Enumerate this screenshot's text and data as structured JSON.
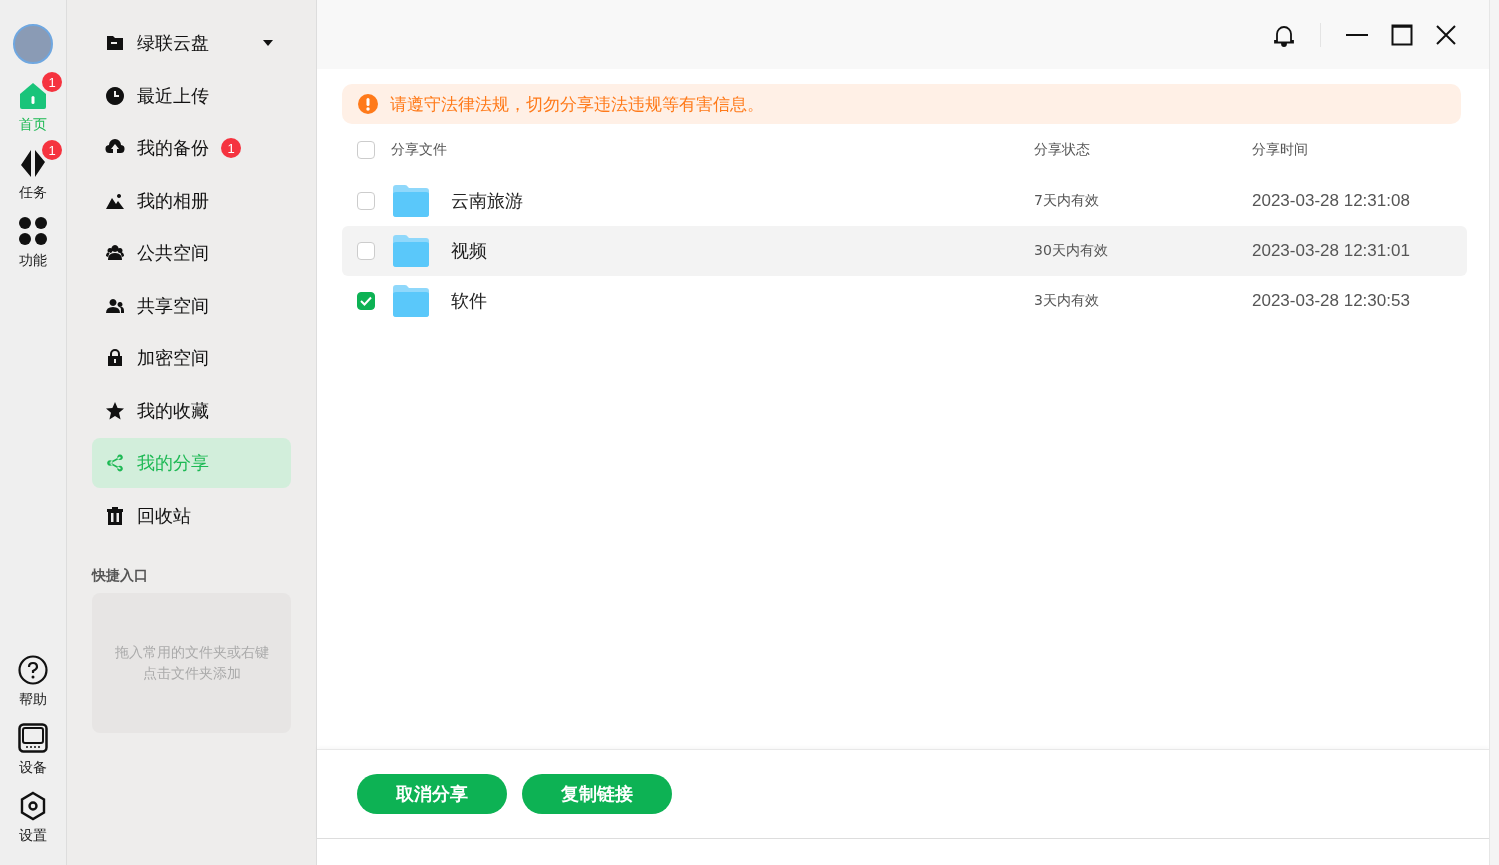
{
  "rail": {
    "top": [
      {
        "kind": "home",
        "label": "首页",
        "selected": true,
        "badge": "1"
      },
      {
        "kind": "tasks",
        "label": "任务",
        "selected": false,
        "badge": "1"
      },
      {
        "kind": "apps",
        "label": "功能",
        "selected": false
      }
    ],
    "bottom": [
      {
        "kind": "help",
        "label": "帮助",
        "selected": false
      },
      {
        "kind": "device",
        "label": "设备",
        "selected": false
      },
      {
        "kind": "settings",
        "label": "设置",
        "selected": false
      }
    ]
  },
  "sidebar": {
    "items": [
      {
        "kind": "drive",
        "label": "绿联云盘",
        "selected": false,
        "dropdown": true
      },
      {
        "kind": "recent",
        "label": "最近上传",
        "selected": false
      },
      {
        "kind": "backup",
        "label": "我的备份",
        "selected": false,
        "badge": "1"
      },
      {
        "kind": "album",
        "label": "我的相册",
        "selected": false
      },
      {
        "kind": "public",
        "label": "公共空间",
        "selected": false
      },
      {
        "kind": "shared",
        "label": "共享空间",
        "selected": false
      },
      {
        "kind": "lock",
        "label": "加密空间",
        "selected": false
      },
      {
        "kind": "star",
        "label": "我的收藏",
        "selected": false
      },
      {
        "kind": "share",
        "label": "我的分享",
        "selected": true
      },
      {
        "kind": "trash",
        "label": "回收站",
        "selected": false
      }
    ],
    "quick_access": {
      "title": "快捷入口",
      "placeholder": "拖入常用的文件夹或右键点击文件夹添加"
    }
  },
  "notice": "请遵守法律法规，切勿分享违法违规等有害信息。",
  "table": {
    "select_all_checked": false,
    "columns": [
      "分享文件",
      "分享状态",
      "分享时间"
    ],
    "rows": [
      {
        "name": "云南旅游",
        "status": "7天内有效",
        "time": "2023-03-28 12:31:08",
        "checked": false,
        "hovered": false
      },
      {
        "name": "视频",
        "status": "30天内有效",
        "time": "2023-03-28 12:31:01",
        "checked": false,
        "hovered": true
      },
      {
        "name": "软件",
        "status": "3天内有效",
        "time": "2023-03-28 12:30:53",
        "checked": true,
        "hovered": false
      }
    ]
  },
  "buttons": [
    "取消分享",
    "复制链接"
  ]
}
